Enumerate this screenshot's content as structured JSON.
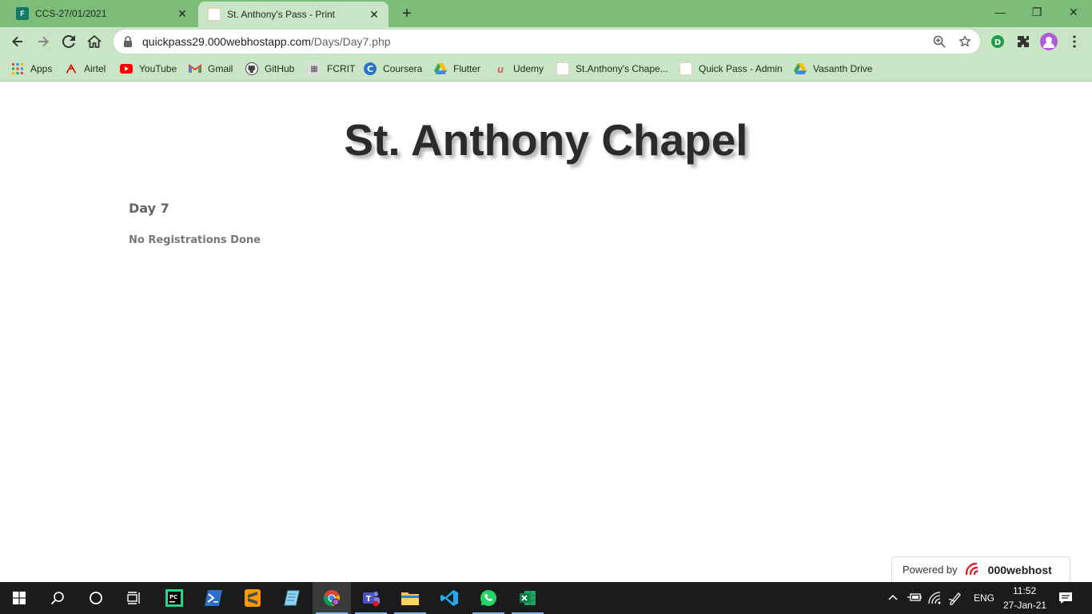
{
  "tabs": [
    {
      "title": "CCS-27/01/2021",
      "favicon": "microsoft-forms-icon"
    },
    {
      "title": "St. Anthony's Pass - Print",
      "favicon": "chapel-favicon"
    }
  ],
  "toolbar": {
    "url_host": "quickpass29.000webhostapp.com",
    "url_path": "/Days/Day7.php"
  },
  "bookmarks": [
    {
      "label": "Apps",
      "icon": "apps-grid-icon"
    },
    {
      "label": "Airtel",
      "icon": "airtel-icon"
    },
    {
      "label": "YouTube",
      "icon": "youtube-icon"
    },
    {
      "label": "Gmail",
      "icon": "gmail-icon"
    },
    {
      "label": "GitHub",
      "icon": "github-icon"
    },
    {
      "label": "FCRIT",
      "icon": "fcrit-icon"
    },
    {
      "label": "Coursera",
      "icon": "coursera-icon"
    },
    {
      "label": "Flutter",
      "icon": "google-drive-icon"
    },
    {
      "label": "Udemy",
      "icon": "udemy-icon"
    },
    {
      "label": "St.Anthony's Chape...",
      "icon": "chapel-favicon"
    },
    {
      "label": "Quick Pass - Admin",
      "icon": "chapel-favicon"
    },
    {
      "label": "Vasanth Drive",
      "icon": "google-drive-icon"
    }
  ],
  "page": {
    "title": "St. Anthony Chapel",
    "day": "Day 7",
    "message": "No Registrations Done",
    "powered_by": "Powered by",
    "brand": "000webhost"
  },
  "taskbar": {
    "language": "ENG",
    "time": "11:52",
    "date": "27-Jan-21"
  },
  "colors": {
    "tabstrip": "#7dbd7a",
    "toolbar": "#c8e5c5",
    "taskbar": "#1b1b1b"
  }
}
